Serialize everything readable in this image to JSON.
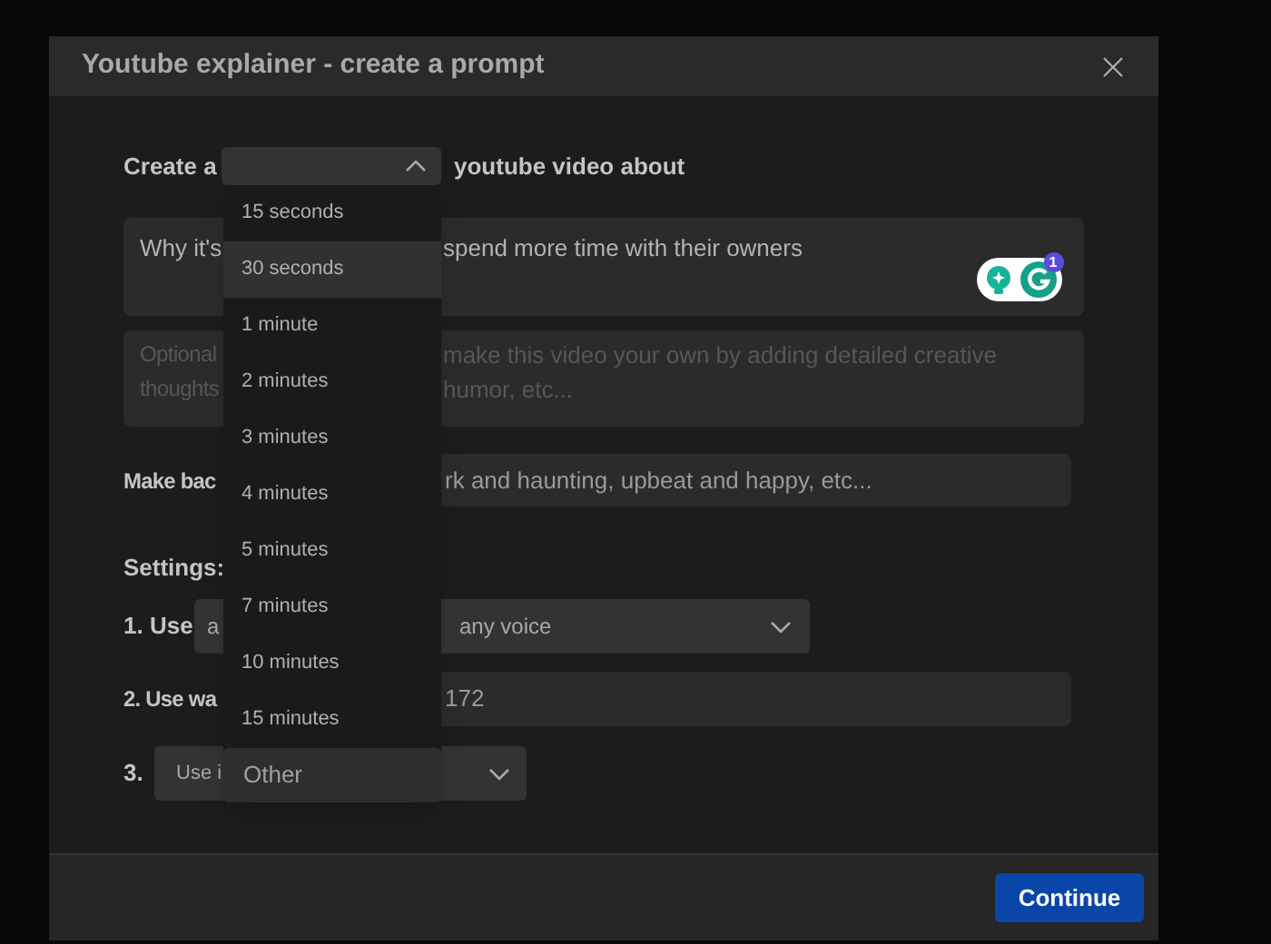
{
  "dialog": {
    "title": "Youtube explainer - create a prompt"
  },
  "prompt_row": {
    "prefix": "Create a",
    "length_select": {
      "expanded": true
    },
    "suffix": "youtube video about"
  },
  "topic_field": {
    "value_left": "Why it's",
    "value_right": "spend more time with their owners"
  },
  "grammarly": {
    "count": "1"
  },
  "details_field": {
    "placeholder_left": [
      "Optional",
      "thoughts"
    ],
    "placeholder_right": [
      "make this video your own by adding detailed creative",
      "humor, etc..."
    ]
  },
  "music_row": {
    "label": "Make bac",
    "placeholder": "rk and haunting, upbeat and happy, etc..."
  },
  "settings_label": "Settings:",
  "settings": [
    {
      "kind": "double_select",
      "label": "1. Use",
      "first_value": "a",
      "second_value": "any voice"
    },
    {
      "kind": "field",
      "label": "2. Use wa",
      "value": "172"
    },
    {
      "kind": "select",
      "label": "3.",
      "value": "Use i"
    }
  ],
  "menu": {
    "options": [
      {
        "kind": "option",
        "label": "15 seconds",
        "selected": false
      },
      {
        "kind": "option",
        "label": "30 seconds",
        "selected": true
      },
      {
        "kind": "option",
        "label": "1 minute",
        "selected": false
      },
      {
        "kind": "option",
        "label": "2 minutes",
        "selected": false
      },
      {
        "kind": "option",
        "label": "3 minutes",
        "selected": false
      },
      {
        "kind": "option",
        "label": "4 minutes",
        "selected": false
      },
      {
        "kind": "option",
        "label": "5 minutes",
        "selected": false
      },
      {
        "kind": "option",
        "label": "7 minutes",
        "selected": false
      },
      {
        "kind": "option",
        "label": "10 minutes",
        "selected": false
      },
      {
        "kind": "option",
        "label": "15 minutes",
        "selected": false
      },
      {
        "kind": "custom",
        "label": "Other",
        "selected": false
      }
    ]
  },
  "footer": {
    "button": "Continue"
  }
}
